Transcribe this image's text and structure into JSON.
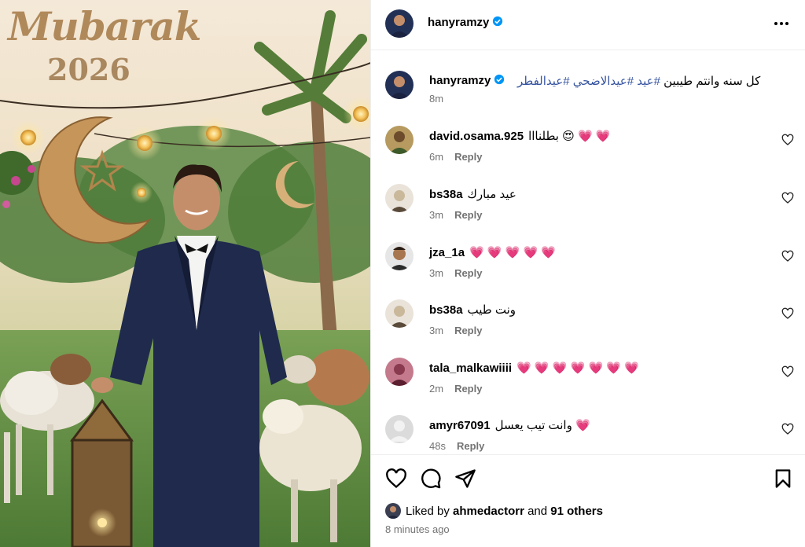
{
  "photo": {
    "title": "Mubarak",
    "year": "2026"
  },
  "post": {
    "username": "hanyramzy",
    "verified": true,
    "more_label": "More options"
  },
  "caption": {
    "username": "hanyramzy",
    "text_plain": "كل سنه وانتم طيبين ",
    "hashtags": "#عيد #عيدالاضحي #عيدالفطر",
    "time": "8m"
  },
  "comments": [
    {
      "username": "david.osama.925",
      "text": "بطلنااا 😍 💗 💗",
      "time": "6m",
      "reply": "Reply",
      "avatar_color": "#b69a5f"
    },
    {
      "username": "bs38a",
      "text": "عيد مبارك",
      "time": "3m",
      "reply": "Reply",
      "avatar_color": "#c9b89a"
    },
    {
      "username": "jza_1a",
      "text": "💗 💗 💗 💗 💗",
      "time": "3m",
      "reply": "Reply",
      "avatar_color": "#6b4b39"
    },
    {
      "username": "bs38a",
      "text": "ونت طيب",
      "time": "3m",
      "reply": "Reply",
      "avatar_color": "#c9b89a"
    },
    {
      "username": "tala_malkawiiii",
      "text": "💗 💗 💗 💗 💗 💗 💗",
      "time": "2m",
      "reply": "Reply",
      "avatar_color": "#8a3a4f"
    },
    {
      "username": "amyr67091",
      "text": "وانت تيب يعسل 💗",
      "time": "48s",
      "reply": "Reply",
      "avatar_color": "#c7c7c7"
    }
  ],
  "likes": {
    "prefix": "Liked by ",
    "user": "ahmedactorr",
    "middle": " and ",
    "others": "91 others"
  },
  "time_ago": "8 minutes ago",
  "colors": {
    "hashtag": "#3654a0",
    "muted": "#737373",
    "verified": "#0095f6"
  }
}
